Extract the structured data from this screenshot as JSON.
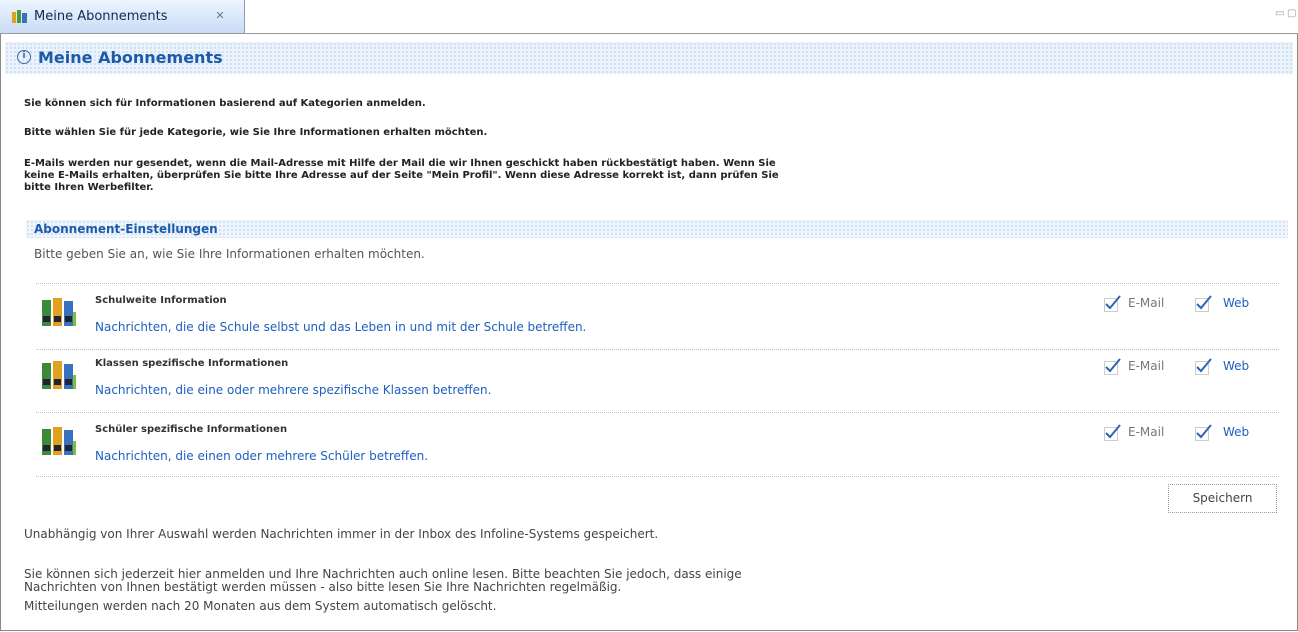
{
  "tab": {
    "label": "Meine Abonnements",
    "close": "✕"
  },
  "window_controls": {
    "minimize": "▭",
    "maximize": "▢"
  },
  "page": {
    "title": "Meine Abonnements"
  },
  "intro": {
    "line1": "Sie können sich für Informationen basierend auf Kategorien anmelden.",
    "line2": "Bitte wählen Sie für jede Kategorie, wie Sie Ihre Informationen erhalten möchten.",
    "line3a": "E-Mails werden nur gesendet, wenn die Mail-Adresse mit Hilfe der Mail die wir Ihnen geschickt haben rückbestätigt haben. Wenn Sie",
    "line3b": "keine E-Mails erhalten, überprüfen Sie bitte Ihre Adresse auf der Seite \"Mein Profil\". Wenn diese Adresse korrekt ist, dann prüfen Sie",
    "line3c": "bitte Ihren Werbefilter."
  },
  "section": {
    "title": "Abonnement-Einstellungen",
    "subtitle": "Bitte geben Sie an, wie Sie Ihre Informationen erhalten möchten."
  },
  "subscriptions": [
    {
      "title": "Schulweite Information",
      "description": "Nachrichten, die die Schule selbst und das Leben in und mit der Schule betreffen.",
      "email_label": "E-Mail",
      "email_checked": true,
      "web_label": "Web",
      "web_checked": true
    },
    {
      "title": "Klassen spezifische Informationen",
      "description": "Nachrichten, die eine oder mehrere spezifische Klassen betreffen.",
      "email_label": "E-Mail",
      "email_checked": true,
      "web_label": "Web",
      "web_checked": true
    },
    {
      "title": "Schüler spezifische Informationen",
      "description": "Nachrichten, die einen oder mehrere Schüler betreffen.",
      "email_label": "E-Mail",
      "email_checked": true,
      "web_label": "Web",
      "web_checked": true
    }
  ],
  "save_button": "Speichern",
  "footer": {
    "line1": "Unabhängig von Ihrer Auswahl werden Nachrichten immer in der Inbox des Infoline-Systems gespeichert.",
    "line2a": "Sie können sich jederzeit hier anmelden und Ihre Nachrichten auch online lesen. Bitte beachten Sie jedoch, dass einige",
    "line2b": "Nachrichten von Ihnen bestätigt werden müssen - also bitte lesen Sie Ihre Nachrichten regelmäßig.",
    "line3": "Mitteilungen werden nach 20 Monaten aus dem System automatisch gelöscht."
  },
  "colors": {
    "accent": "#1d5ba8",
    "link": "#1e5fbf",
    "header_bg": "#eaf3fb"
  },
  "icons": {
    "tab": "subscription-icon",
    "header": "info-icon",
    "category": "binders-icon",
    "checkbox": "checkmark-icon"
  }
}
